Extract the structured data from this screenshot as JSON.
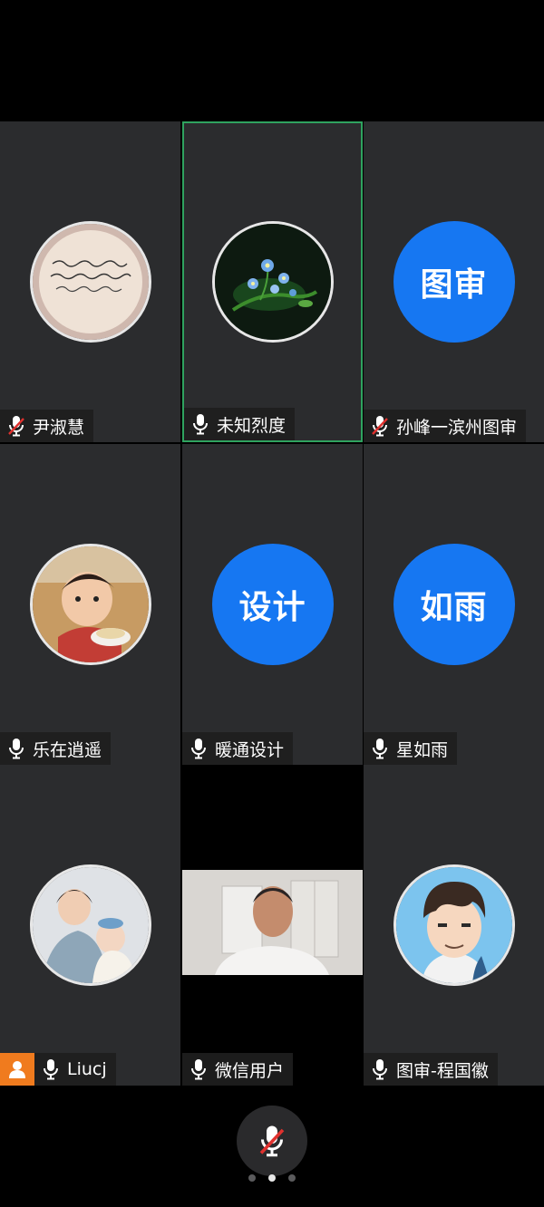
{
  "participants": [
    {
      "name": "尹淑慧",
      "avatar_icon": "handwriting-note-avatar",
      "mic": "muted"
    },
    {
      "name": "未知烈度",
      "avatar_icon": "blue-flowers-avatar",
      "mic": "on",
      "speaking": true
    },
    {
      "name": "孙峰一滨州图审",
      "avatar_text": "图审",
      "mic": "muted"
    },
    {
      "name": "乐在逍遥",
      "avatar_icon": "child-eating-avatar",
      "mic": "on"
    },
    {
      "name": "暖通设计",
      "avatar_text": "设计",
      "mic": "on"
    },
    {
      "name": "星如雨",
      "avatar_text": "如雨",
      "mic": "on"
    },
    {
      "name": "Liucj",
      "avatar_icon": "mother-baby-avatar",
      "mic": "on",
      "host_badge": "person-icon"
    },
    {
      "name": "微信用户",
      "video": "man-in-office-video",
      "mic": "on"
    },
    {
      "name": "图审-程国徽",
      "avatar_icon": "cartoon-man-avatar",
      "mic": "on"
    }
  ],
  "controls": {
    "mic_button": "mic-muted-icon"
  },
  "pager": {
    "pages": 3,
    "current": 2
  },
  "colors": {
    "avatar_blue": "#1677f2",
    "active_border": "#2fa35f",
    "muted_red": "#e0312e",
    "host_orange": "#f07b1e"
  }
}
